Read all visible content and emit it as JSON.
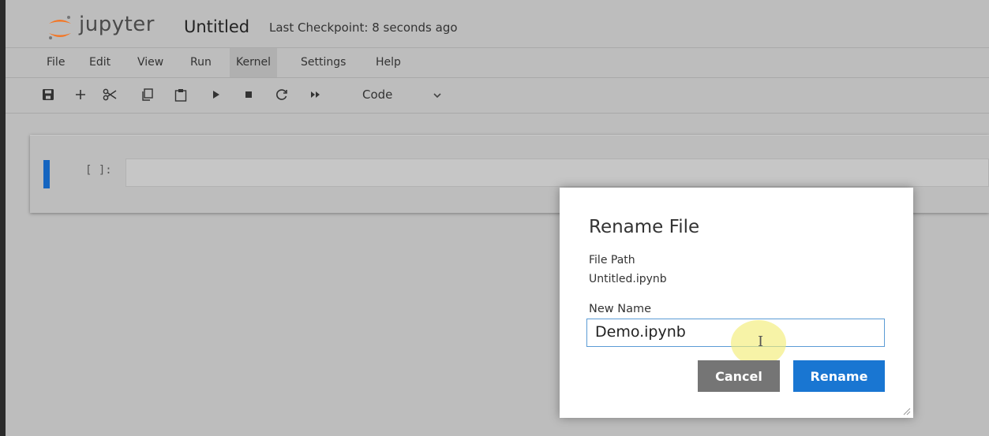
{
  "header": {
    "logo_text": "jupyter",
    "notebook_title": "Untitled",
    "checkpoint_status": "Last Checkpoint: 8 seconds ago"
  },
  "menu": {
    "items": [
      {
        "label": "File"
      },
      {
        "label": "Edit"
      },
      {
        "label": "View"
      },
      {
        "label": "Run"
      },
      {
        "label": "Kernel"
      },
      {
        "label": "Settings"
      },
      {
        "label": "Help"
      }
    ],
    "active": "Kernel"
  },
  "toolbar": {
    "icons": [
      "save-icon",
      "add-cell-icon",
      "cut-icon",
      "copy-icon",
      "paste-icon",
      "run-icon",
      "stop-icon",
      "restart-icon",
      "fast-forward-icon"
    ],
    "cell_type": "Code"
  },
  "cell": {
    "prompt": "[ ]:",
    "content": ""
  },
  "dialog": {
    "title": "Rename File",
    "file_path_label": "File Path",
    "file_path_value": "Untitled.ipynb",
    "new_name_label": "New Name",
    "new_name_value": "Demo.ipynb",
    "cancel_label": "Cancel",
    "rename_label": "Rename"
  },
  "colors": {
    "accent": "#1976d2",
    "cancel_button": "#757575",
    "cell_marker": "#1565c0",
    "logo_orange": "#f37726",
    "background": "#bdbdbd"
  }
}
